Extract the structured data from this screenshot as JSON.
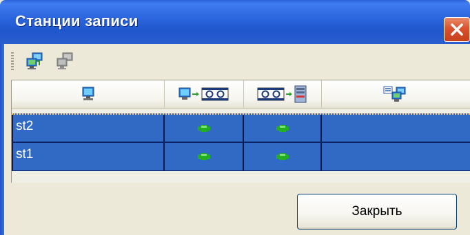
{
  "window": {
    "title": "Станции записи",
    "close_icon": "close-x-icon"
  },
  "toolbar": {
    "buttons": [
      {
        "icon": "network-computers-icon",
        "enabled": true
      },
      {
        "icon": "network-computers-disabled-icon",
        "enabled": false
      }
    ]
  },
  "grid": {
    "columns": [
      {
        "icon": "computer-icon"
      },
      {
        "icon": "computer-to-tape-icon"
      },
      {
        "icon": "tape-to-server-icon"
      },
      {
        "icon": "list-network-icon"
      }
    ],
    "rows": [
      {
        "name": "st2",
        "col1_icon": "green-connected-icon",
        "col2_icon": "green-connected-icon",
        "col3": ""
      },
      {
        "name": "st1",
        "col1_icon": "green-connected-icon",
        "col2_icon": "green-connected-icon",
        "col3": ""
      }
    ]
  },
  "footer": {
    "close_label": "Закрыть"
  },
  "colors": {
    "titlebar": "#2a64dc",
    "selection": "#316ac5",
    "status_ok": "#22b020"
  }
}
